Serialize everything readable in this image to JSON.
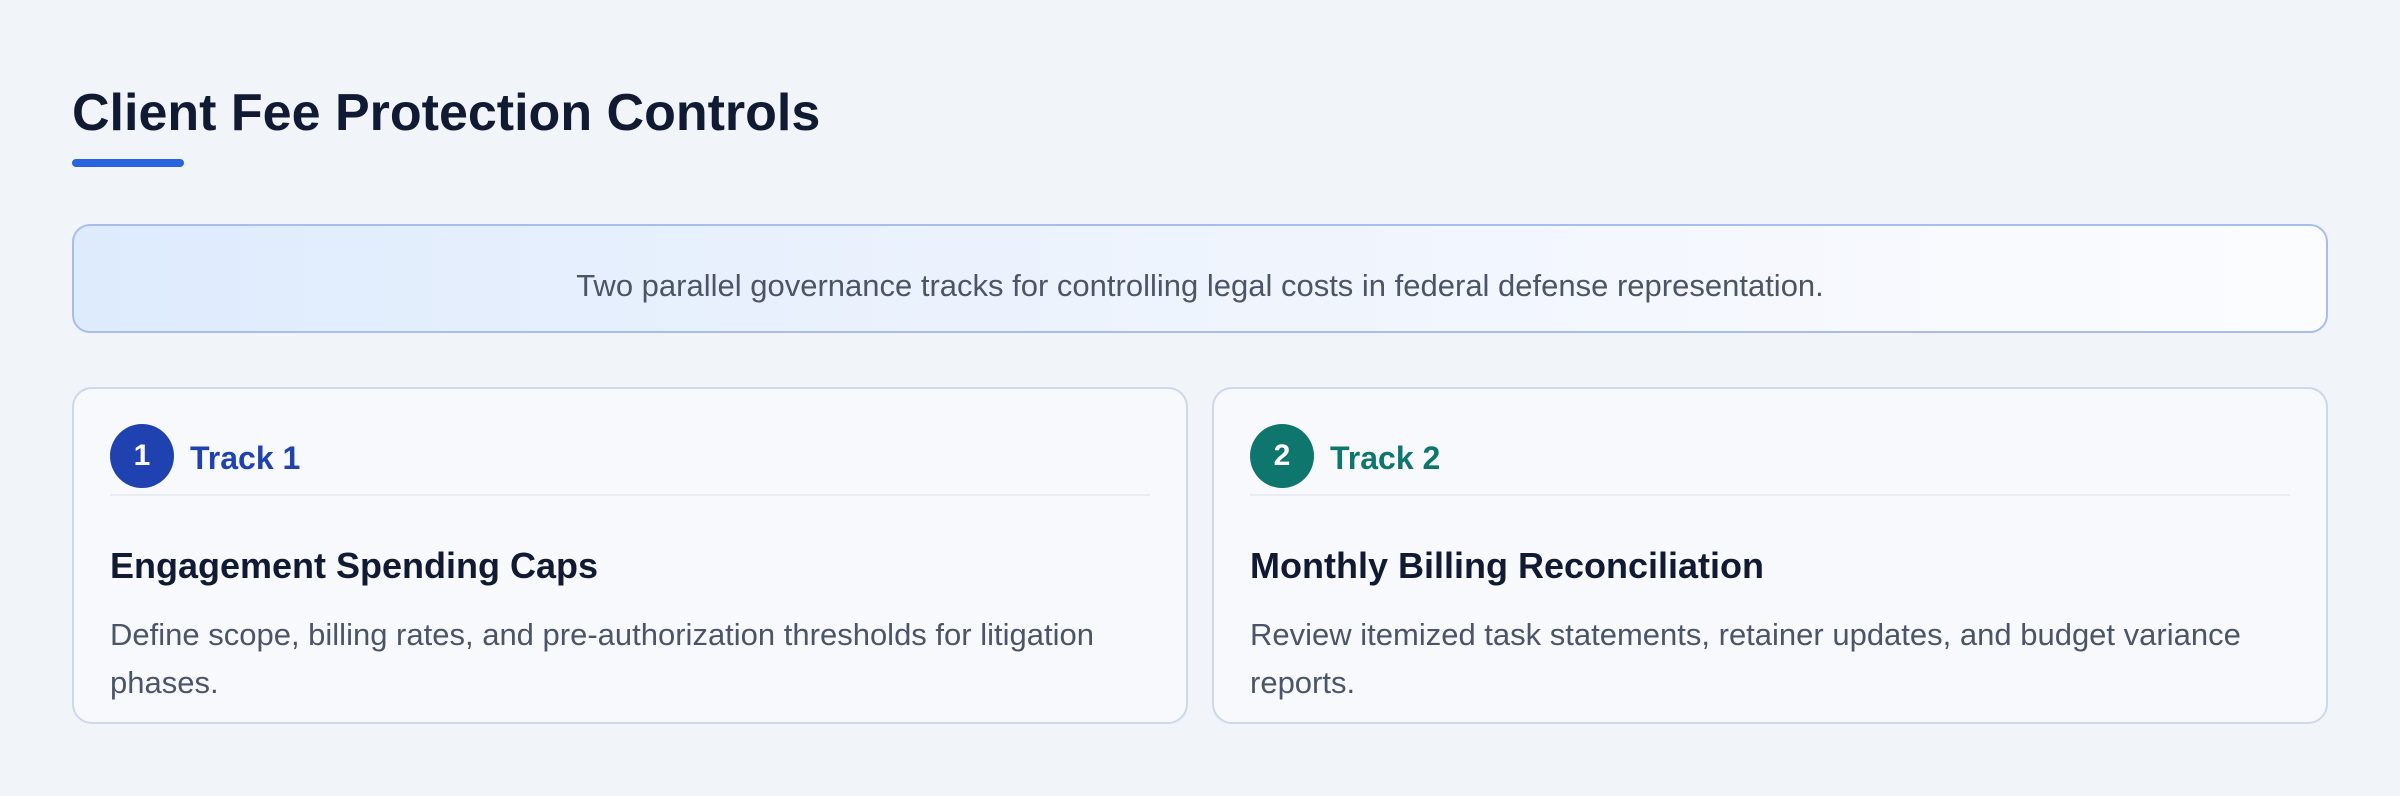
{
  "header": {
    "title": "Client Fee Protection Controls"
  },
  "banner": {
    "text": "Two parallel governance tracks for controlling legal costs in federal defense representation."
  },
  "colors": {
    "accent": "#2a63e0",
    "track1": "#2041b0",
    "track2": "#0f766e",
    "heading": "#111a33",
    "body_text": "#4b5567"
  },
  "tracks": [
    {
      "number": "1",
      "label": "Track 1",
      "title": "Engagement Spending Caps",
      "description": "Define scope, billing rates, and pre-authorization thresholds for litigation phases."
    },
    {
      "number": "2",
      "label": "Track 2",
      "title": "Monthly Billing Reconciliation",
      "description": "Review itemized task statements, retainer updates, and budget variance reports."
    }
  ]
}
